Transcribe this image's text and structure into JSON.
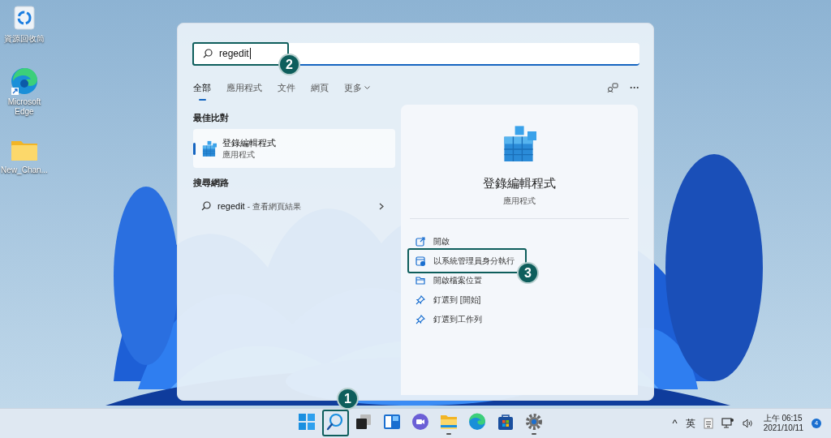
{
  "desktop_icons": [
    {
      "kind": "recycle",
      "label": "資源回收筒"
    },
    {
      "kind": "edge",
      "label": "Microsoft Edge"
    },
    {
      "kind": "folder",
      "label": "New_Chan..."
    }
  ],
  "search": {
    "value": "regedit"
  },
  "tabs": [
    {
      "label": "全部",
      "selected": true,
      "has_menu": false
    },
    {
      "label": "應用程式",
      "selected": false,
      "has_menu": false
    },
    {
      "label": "文件",
      "selected": false,
      "has_menu": false
    },
    {
      "label": "網頁",
      "selected": false,
      "has_menu": false
    },
    {
      "label": "更多",
      "selected": false,
      "has_menu": true
    }
  ],
  "more_button": {
    "label": "···"
  },
  "best_match": {
    "heading": "最佳比對",
    "title": "登錄編輯程式",
    "subtitle": "應用程式",
    "selected": true
  },
  "web_search": {
    "heading": "搜尋網路",
    "query": "regedit",
    "suffix": "- 查看網頁結果"
  },
  "detail": {
    "title": "登錄編輯程式",
    "subtitle": "應用程式",
    "actions": [
      {
        "kind": "open",
        "label": "開啟"
      },
      {
        "kind": "admin",
        "label": "以系統管理員身分執行"
      },
      {
        "kind": "folder",
        "label": "開啟檔案位置"
      },
      {
        "kind": "pin",
        "label": "釘選到 [開始]"
      },
      {
        "kind": "pin",
        "label": "釘選到工作列"
      }
    ]
  },
  "taskbar": [
    {
      "kind": "start",
      "running": false
    },
    {
      "kind": "search",
      "running": false
    },
    {
      "kind": "taskview",
      "running": false
    },
    {
      "kind": "widgets",
      "running": false
    },
    {
      "kind": "chat",
      "running": false
    },
    {
      "kind": "explorer",
      "running": true
    },
    {
      "kind": "edge",
      "running": false
    },
    {
      "kind": "store",
      "running": false
    },
    {
      "kind": "settings",
      "running": true
    }
  ],
  "tray": {
    "caret": "^",
    "ime": "英",
    "time": "上午 06:15",
    "date": "2021/10/11",
    "notifications": "4"
  },
  "annotations": [
    {
      "number": "1"
    },
    {
      "number": "2"
    },
    {
      "number": "3"
    }
  ]
}
